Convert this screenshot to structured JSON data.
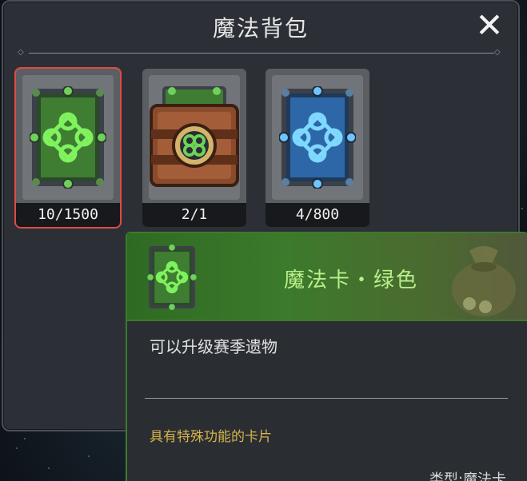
{
  "window": {
    "title": "魔法背包",
    "close_icon": "close-x-icon"
  },
  "inventory": {
    "items": [
      {
        "name": "green-magic-card",
        "quantity": "10/1500",
        "selected": true,
        "color": "#3aa832"
      },
      {
        "name": "leather-card-book",
        "quantity": "2/1",
        "selected": false,
        "color": "#8a4b2c"
      },
      {
        "name": "blue-magic-card",
        "quantity": "4/800",
        "selected": false,
        "color": "#3a8fd6"
      }
    ]
  },
  "detail": {
    "name": "魔法卡・绿色",
    "description": "可以升级赛季遗物",
    "feature": "具有特殊功能的卡片",
    "type_label": "类型:魔法卡",
    "icon": "green-magic-card-icon",
    "decor_icon": "coin-bag-icon"
  },
  "colors": {
    "accent_green": "#3d7a2c",
    "name_green": "#b8f08a",
    "feature_gold": "#d6b34a",
    "selected_red": "#e04a44"
  }
}
